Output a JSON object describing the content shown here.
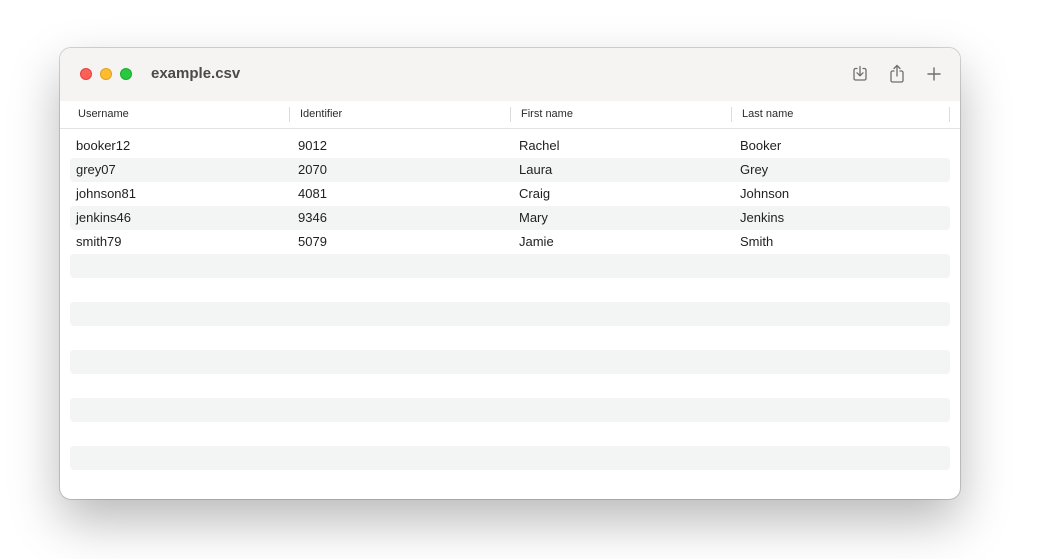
{
  "window": {
    "title": "example.csv"
  },
  "toolbar": {
    "icons": [
      "download-icon",
      "share-icon",
      "plus-icon"
    ]
  },
  "table": {
    "columns": [
      "Username",
      "Identifier",
      "First name",
      "Last name"
    ],
    "rows": [
      [
        "booker12",
        "9012",
        "Rachel",
        "Booker"
      ],
      [
        "grey07",
        "2070",
        "Laura",
        "Grey"
      ],
      [
        "johnson81",
        "4081",
        "Craig",
        "Johnson"
      ],
      [
        "jenkins46",
        "9346",
        "Mary",
        "Jenkins"
      ],
      [
        "smith79",
        "5079",
        "Jamie",
        "Smith"
      ]
    ]
  },
  "colors": {
    "close": "#fe5f57",
    "minimize": "#febc2e",
    "zoom": "#28c840",
    "row_alt": "#f3f4f4"
  }
}
